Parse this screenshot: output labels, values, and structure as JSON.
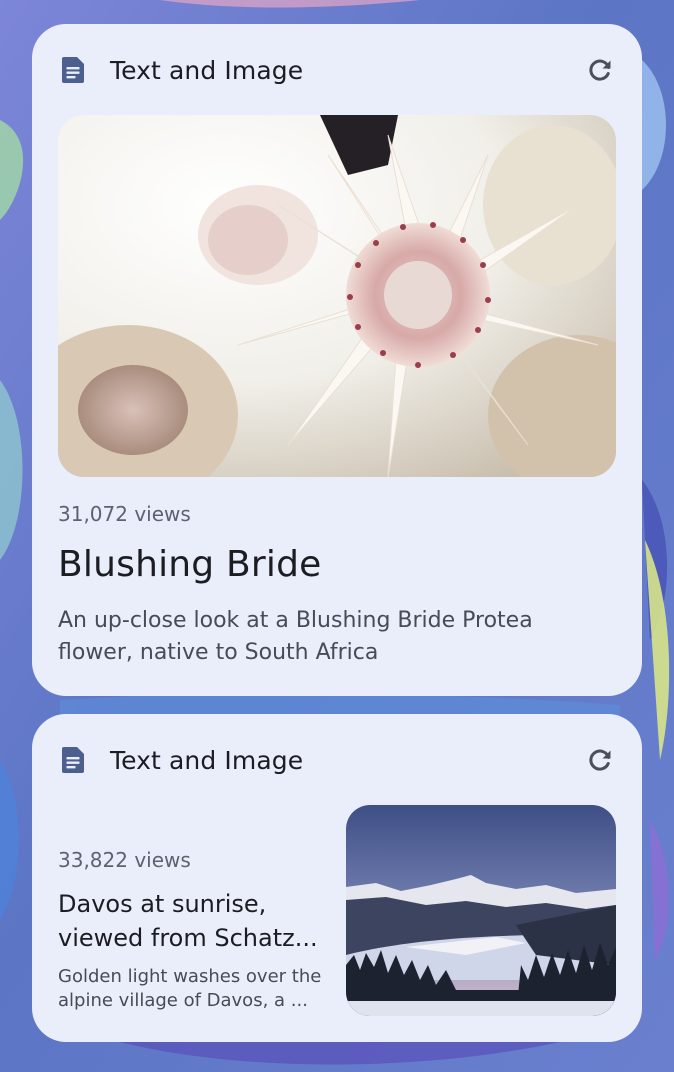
{
  "widgets": [
    {
      "title": "Text and Image",
      "header_icon": "document-icon",
      "action_icon": "refresh-icon",
      "views": "31,072 views",
      "headline": "Blushing Bride",
      "description": "An up-close look at a Blushing Bride Protea flower, native to South Africa",
      "image": "protea-flower-photo"
    },
    {
      "title": "Text and Image",
      "header_icon": "document-icon",
      "action_icon": "refresh-icon",
      "views": "33,822 views",
      "headline": "Davos at sunrise, viewed from Schatz...",
      "description": "Golden light washes over the alpine village of Davos, a ...",
      "image": "davos-sunrise-photo"
    }
  ],
  "colors": {
    "card_background": "#eaeefb",
    "icon_blue": "#4d5f8f",
    "wallpaper_base": "#6a78c9"
  }
}
